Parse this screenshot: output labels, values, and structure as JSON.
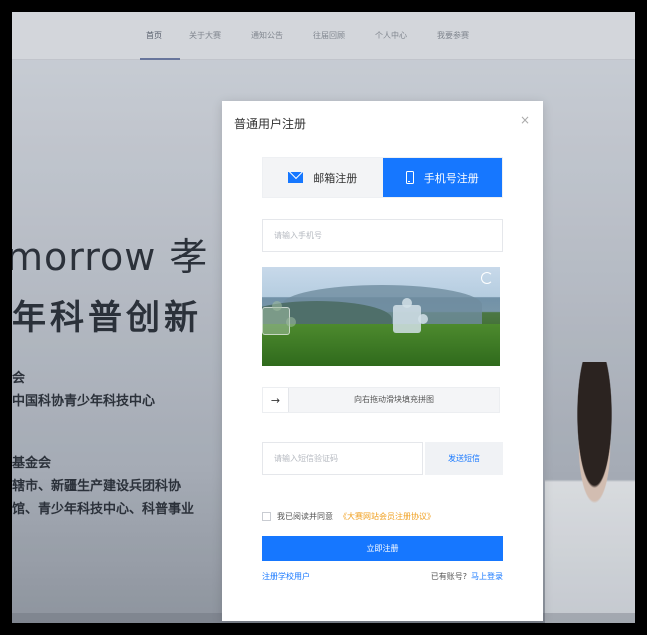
{
  "nav": {
    "items": [
      "首页",
      "关于大赛",
      "通知公告",
      "往届回顾",
      "个人中心",
      "我要参赛"
    ]
  },
  "hero": {
    "big_text": "morrow 孝",
    "cn_title": "年科普创新",
    "line1": "会",
    "line2": "中国科协青少年科技中心",
    "line3": "基金会",
    "line4": "辖市、新疆生产建设兵团科协",
    "line5": "馆、青少年科技中心、科普事业"
  },
  "modal": {
    "title": "普通用户注册",
    "close": "×",
    "tab_email": "邮箱注册",
    "tab_phone": "手机号注册",
    "phone_placeholder": "请输入手机号",
    "slider_arrow": "→",
    "slider_text": "向右拖动滑块填充拼图",
    "sms_placeholder": "请输入短信验证码",
    "sms_button": "发送短信",
    "agree_text": "我已阅读并同意",
    "agree_link": "《大赛网站会员注册协议》",
    "submit": "立即注册",
    "register_school": "注册学校用户",
    "has_account": "已有账号?",
    "login": "马上登录"
  },
  "colors": {
    "accent": "#1677ff",
    "link_orange": "#f0a020"
  },
  "icons": [
    "mail-icon",
    "phone-icon",
    "refresh-icon",
    "close-icon",
    "arrow-right-icon"
  ]
}
